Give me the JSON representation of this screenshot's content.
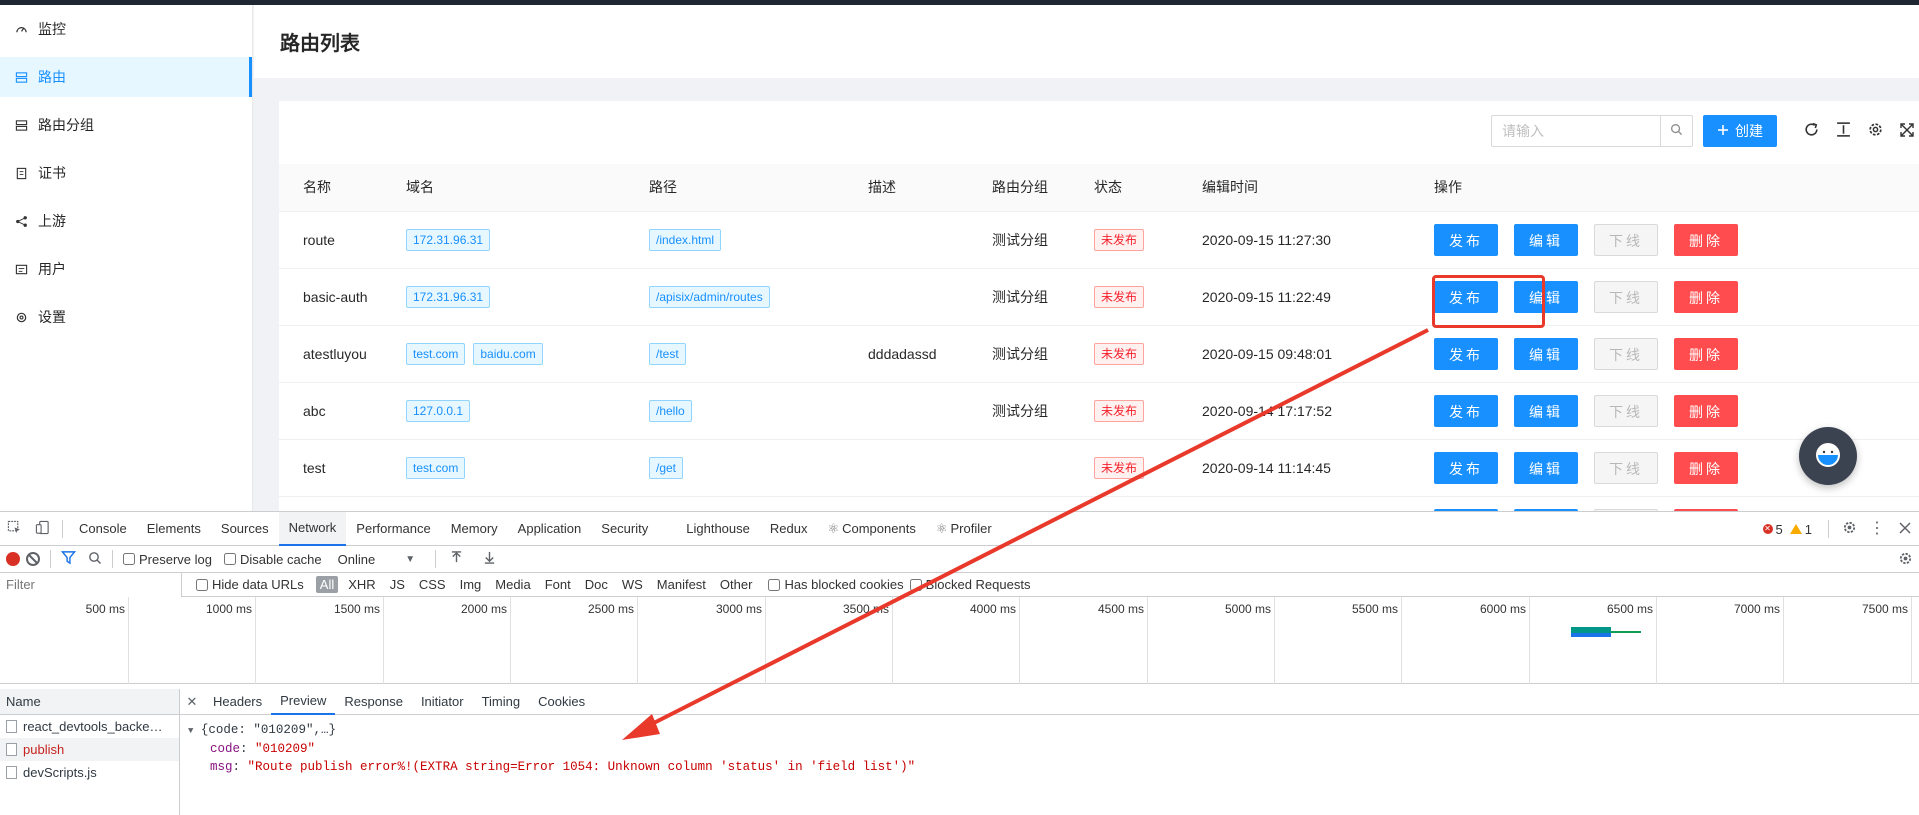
{
  "sidebar": {
    "items": [
      {
        "label": "监控",
        "icon": "dashboard-icon"
      },
      {
        "label": "路由",
        "icon": "route-icon",
        "active": true
      },
      {
        "label": "路由分组",
        "icon": "route-group-icon"
      },
      {
        "label": "证书",
        "icon": "certificate-icon"
      },
      {
        "label": "上游",
        "icon": "upstream-icon"
      },
      {
        "label": "用户",
        "icon": "user-icon"
      },
      {
        "label": "设置",
        "icon": "settings-icon"
      }
    ]
  },
  "page": {
    "title": "路由列表"
  },
  "toolbar": {
    "search_placeholder": "请输入",
    "create_label": "创建"
  },
  "table": {
    "headers": [
      "名称",
      "域名",
      "路径",
      "描述",
      "路由分组",
      "状态",
      "编辑时间",
      "操作"
    ],
    "rows": [
      {
        "name": "route",
        "hosts": [
          "172.31.96.31"
        ],
        "paths": [
          "/index.html"
        ],
        "desc": "",
        "group": "测试分组",
        "status": "未发布",
        "time": "2020-09-15 11:27:30"
      },
      {
        "name": "basic-auth",
        "hosts": [
          "172.31.96.31"
        ],
        "paths": [
          "/apisix/admin/routes"
        ],
        "desc": "",
        "group": "测试分组",
        "status": "未发布",
        "time": "2020-09-15 11:22:49"
      },
      {
        "name": "atestluyou",
        "hosts": [
          "test.com",
          "baidu.com"
        ],
        "paths": [
          "/test"
        ],
        "desc": "dddadassd",
        "group": "测试分组",
        "status": "未发布",
        "time": "2020-09-15 09:48:01"
      },
      {
        "name": "abc",
        "hosts": [
          "127.0.0.1"
        ],
        "paths": [
          "/hello"
        ],
        "desc": "",
        "group": "测试分组",
        "status": "未发布",
        "time": "2020-09-14 17:17:52"
      },
      {
        "name": "test",
        "hosts": [
          "test.com"
        ],
        "paths": [
          "/get"
        ],
        "desc": "",
        "group": "",
        "status": "未发布",
        "time": "2020-09-14 11:14:45"
      }
    ],
    "actions": {
      "publish": "发布",
      "edit": "编辑",
      "offline": "下线",
      "delete": "删除"
    }
  },
  "devtools": {
    "tabs": [
      "Console",
      "Elements",
      "Sources",
      "Network",
      "Performance",
      "Memory",
      "Application",
      "Security",
      "Lighthouse",
      "Redux",
      "Components",
      "Profiler"
    ],
    "active_tab": "Network",
    "error_count": "5",
    "warning_count": "1",
    "options": {
      "preserve_log": "Preserve log",
      "disable_cache": "Disable cache",
      "throttle": "Online"
    },
    "filter_placeholder": "Filter",
    "hide_data_urls": "Hide data URLs",
    "types": [
      "All",
      "XHR",
      "JS",
      "CSS",
      "Img",
      "Media",
      "Font",
      "Doc",
      "WS",
      "Manifest",
      "Other"
    ],
    "has_blocked_cookies": "Has blocked cookies",
    "blocked_requests": "Blocked Requests",
    "timeline_ticks": [
      "500 ms",
      "1000 ms",
      "1500 ms",
      "2000 ms",
      "2500 ms",
      "3000 ms",
      "3500 ms",
      "4000 ms",
      "4500 ms",
      "5000 ms",
      "5500 ms",
      "6000 ms",
      "6500 ms",
      "7000 ms",
      "7500 ms"
    ],
    "name_header": "Name",
    "requests": [
      "react_devtools_backe…",
      "publish",
      "devScripts.js"
    ],
    "detail_tabs": [
      "Headers",
      "Preview",
      "Response",
      "Initiator",
      "Timing",
      "Cookies"
    ],
    "preview": {
      "summary": "{code: \"010209\",…}",
      "code_key": "code",
      "code_val": "\"010209\"",
      "msg_key": "msg",
      "msg_val": "\"Route publish error%!(EXTRA string=Error 1054: Unknown column 'status' in 'field list')\""
    }
  },
  "colors": {
    "primary": "#1890ff",
    "danger": "#ff4d4f",
    "annotation": "#e8392b"
  }
}
